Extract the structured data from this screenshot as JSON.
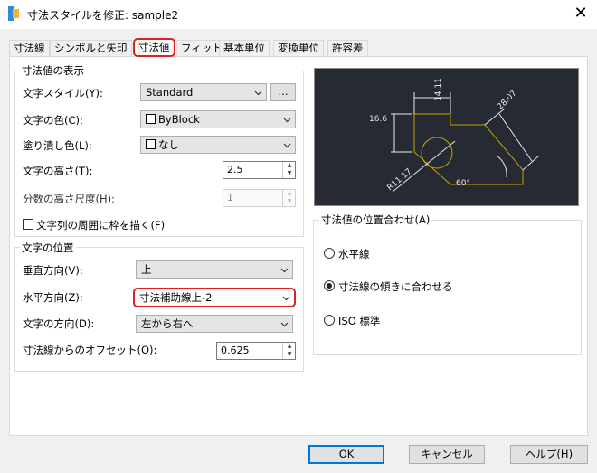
{
  "window": {
    "title": "寸法スタイルを修正: sample2"
  },
  "tabs": [
    "寸法線",
    "シンボルと矢印",
    "寸法値",
    "フィット",
    "基本単位",
    "変換単位",
    "許容差"
  ],
  "text_appearance": {
    "group_title": "寸法値の表示",
    "text_style_label": "文字スタイル(Y):",
    "text_style_value": "Standard",
    "text_style_more": "...",
    "text_color_label": "文字の色(C):",
    "text_color_value": "ByBlock",
    "fill_color_label": "塗り潰し色(L):",
    "fill_color_value": "なし",
    "text_height_label": "文字の高さ(T):",
    "text_height_value": "2.5",
    "fraction_scale_label": "分数の高さ尺度(H):",
    "fraction_scale_value": "1",
    "draw_frame_label": "文字列の周囲に枠を描く(F)"
  },
  "text_placement": {
    "group_title": "文字の位置",
    "vertical_label": "垂直方向(V):",
    "vertical_value": "上",
    "horizontal_label": "水平方向(Z):",
    "horizontal_value": "寸法補助線上-2",
    "view_direction_label": "文字の方向(D):",
    "view_direction_value": "左から右へ",
    "offset_label": "寸法線からのオフセット(O):",
    "offset_value": "0.625"
  },
  "preview": {
    "labels": [
      "14.11",
      "16.6",
      "28.07",
      "R11.17",
      "60°"
    ]
  },
  "text_alignment": {
    "group_title": "寸法値の位置合わせ(A)",
    "options": [
      "水平線",
      "寸法線の傾きに合わせる",
      "ISO 標準"
    ],
    "selected": "寸法線の傾きに合わせる"
  },
  "buttons": {
    "ok": "OK",
    "cancel": "キャンセル",
    "help": "ヘルプ(H)"
  },
  "colors": {
    "accent": "#e02020",
    "preview_bg": "#262b33",
    "preview_geometry": "#c8a000",
    "focus_blue": "#0078d7"
  }
}
